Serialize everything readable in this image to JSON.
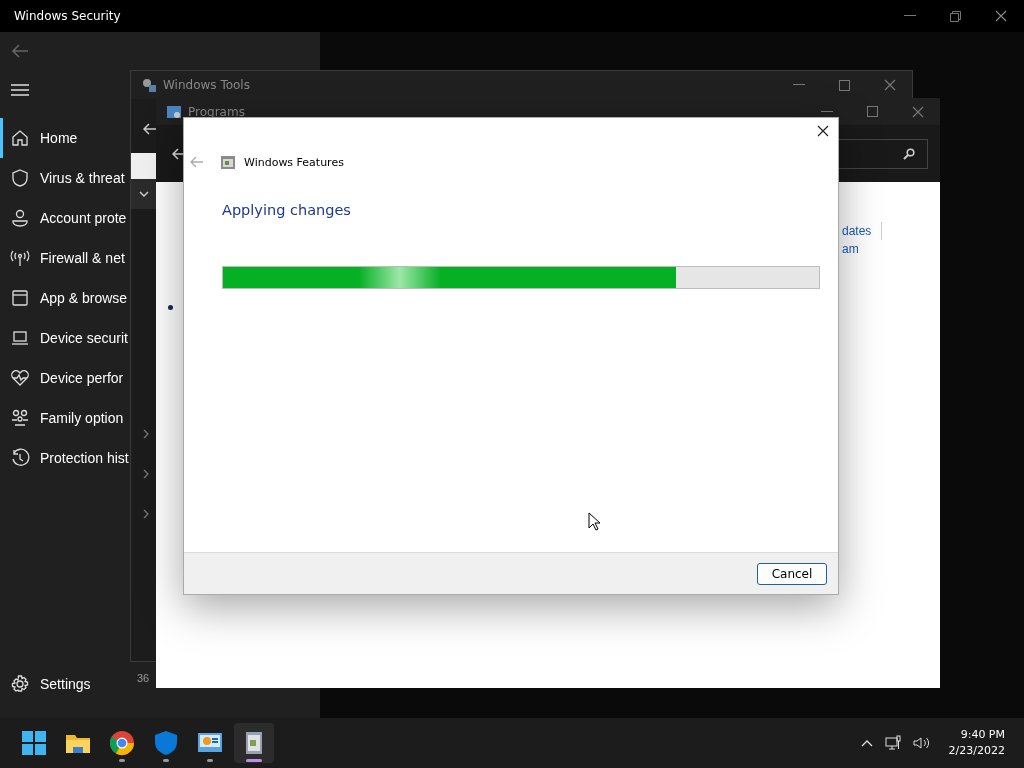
{
  "security_window": {
    "title": "Windows Security",
    "nav_items": [
      {
        "label": "Home",
        "kind": "home",
        "selected": true
      },
      {
        "label": "Virus & threat",
        "kind": "shield",
        "selected": false
      },
      {
        "label": "Account prote",
        "kind": "person",
        "selected": false
      },
      {
        "label": "Firewall & net",
        "kind": "antenna",
        "selected": false
      },
      {
        "label": "App & browse",
        "kind": "window",
        "selected": false
      },
      {
        "label": "Device securit",
        "kind": "laptop",
        "selected": false
      },
      {
        "label": "Device perfor",
        "kind": "heart",
        "selected": false
      },
      {
        "label": "Family option",
        "kind": "family",
        "selected": false
      },
      {
        "label": "Protection hist",
        "kind": "history",
        "selected": false
      }
    ],
    "settings": "Settings"
  },
  "tools_window": {
    "title": "Windows Tools",
    "status": "36"
  },
  "programs_window": {
    "title": "Programs",
    "links": [
      "dates",
      "am"
    ]
  },
  "dialog": {
    "title": "Windows Features",
    "heading": "Applying changes",
    "progress": {
      "level": 0.76
    },
    "buttons": [
      "Cancel"
    ]
  },
  "taskbar": {
    "apps": [
      {
        "kind": "start",
        "running": false,
        "selected": false
      },
      {
        "kind": "folder",
        "running": false,
        "selected": false
      },
      {
        "kind": "browser",
        "running": true,
        "selected": false
      },
      {
        "kind": "shield",
        "running": true,
        "selected": false
      },
      {
        "kind": "panel",
        "running": true,
        "selected": false
      },
      {
        "kind": "features",
        "running": true,
        "selected": true
      }
    ],
    "clock": {
      "time": "9:40 PM",
      "date": "2/23/2022"
    }
  }
}
